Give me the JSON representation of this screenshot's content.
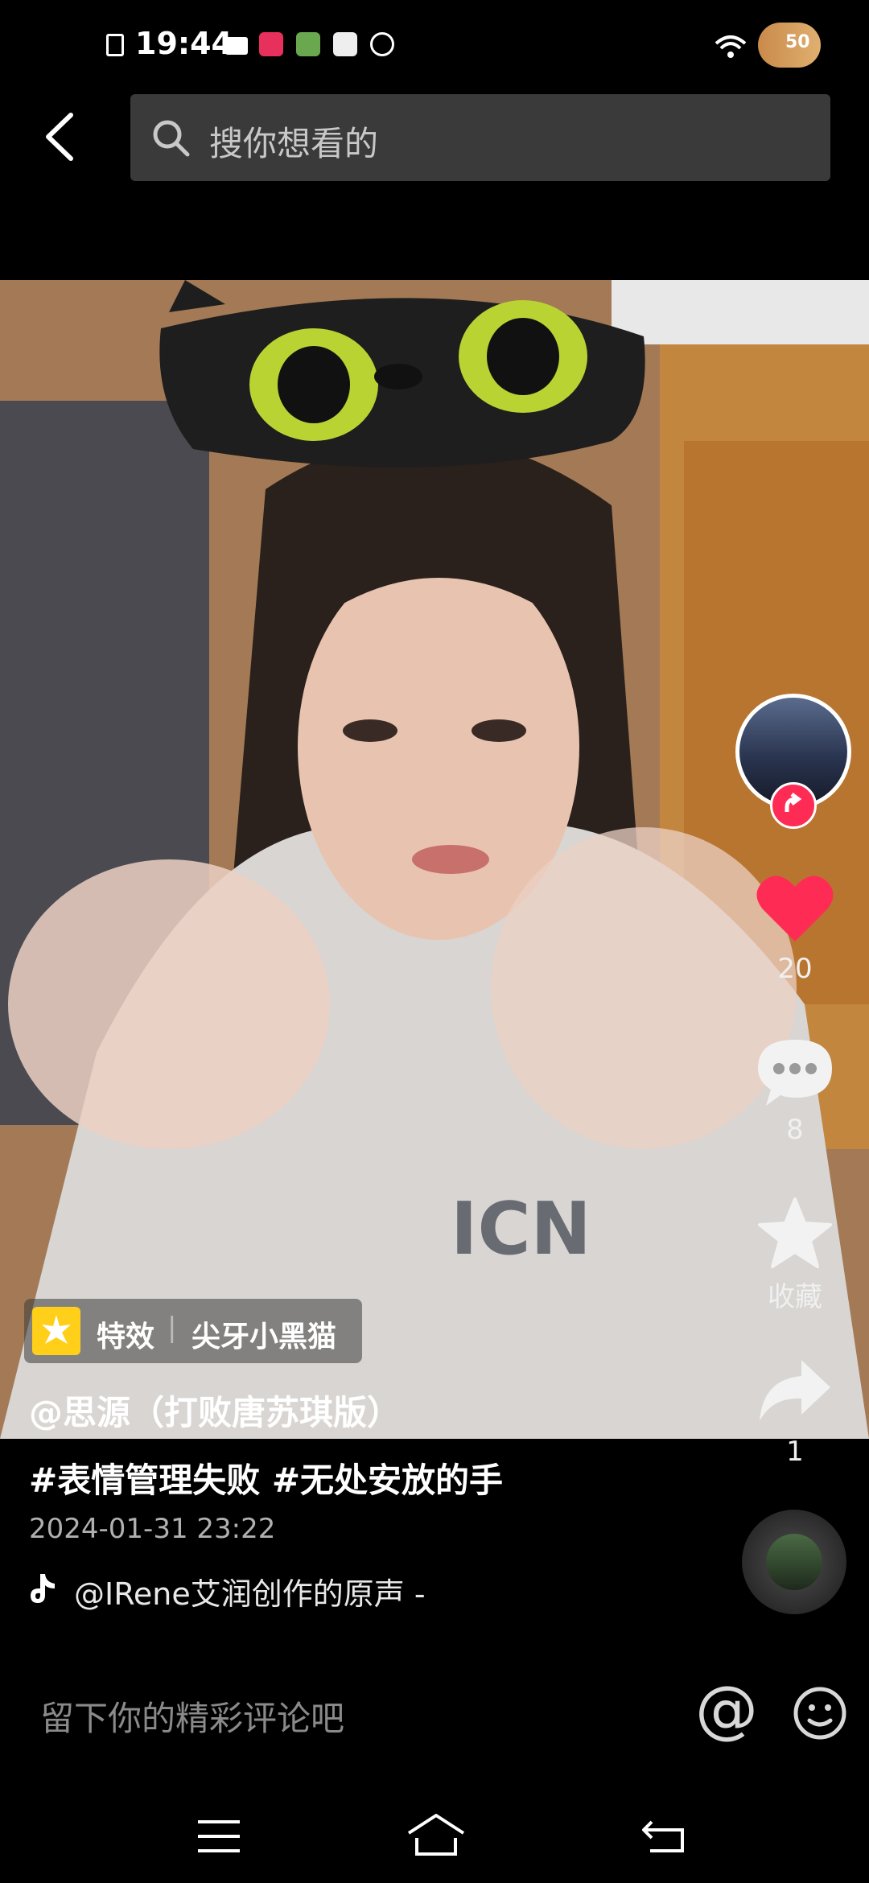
{
  "status_bar": {
    "time": "19:44",
    "battery": "50"
  },
  "search": {
    "placeholder": "搜你想看的"
  },
  "rail": {
    "likes": "20",
    "comments": "8",
    "favorite_label": "收藏",
    "shares": "1"
  },
  "effect": {
    "label": "特效",
    "divider": "|",
    "name": "尖牙小黑猫"
  },
  "video_text": {
    "partial_caption": "ICN"
  },
  "post": {
    "author": "@思源（打败唐苏琪版）",
    "hashtags": "#表情管理失败 #无处安放的手",
    "date": "2024-01-31 23:22",
    "music": "@IRene艾润创作的原声 -"
  },
  "comment": {
    "placeholder": "留下你的精彩评论吧",
    "at_symbol": "@"
  },
  "colors": {
    "like_red": "#fe2c55",
    "follow_red": "#fe2c55",
    "background": "#000000"
  }
}
